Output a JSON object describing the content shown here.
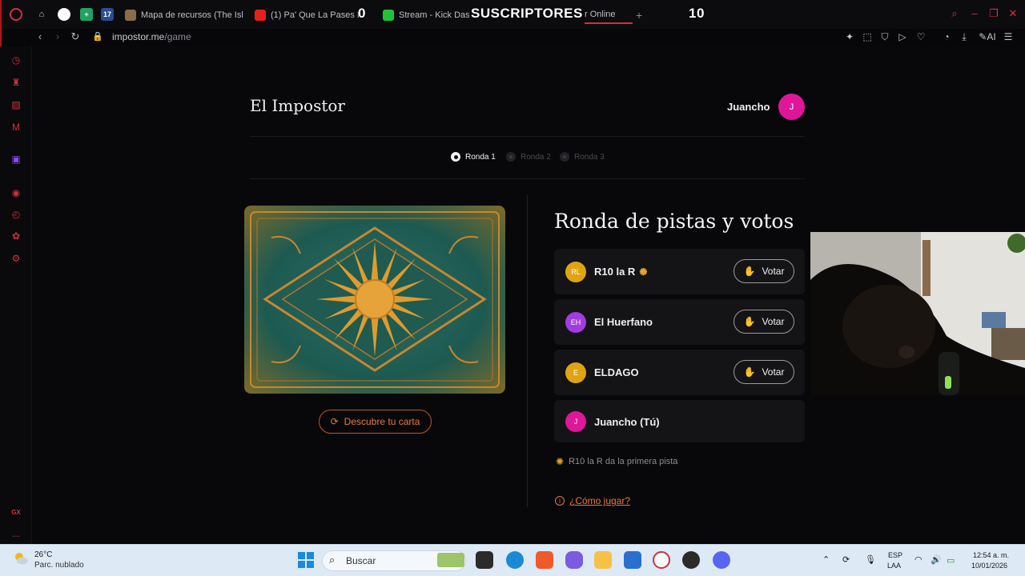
{
  "browser": {
    "tabs": [
      {
        "label": "Mapa de recursos (The Isl"
      },
      {
        "label": "(1) Pa' Que La Pases Bie"
      },
      {
        "label": "Stream - Kick Dash"
      },
      {
        "label": "r Online"
      }
    ],
    "overlay": {
      "subs_count_left": "0",
      "subs_title": "SUSCRIPTORES",
      "subs_count_right": "10"
    },
    "url_host": "impostor.me",
    "url_path": "/game",
    "ai_label": "AI",
    "app_badge": "17"
  },
  "sidebar": {
    "gx_label": "GX",
    "more_label": "..."
  },
  "app": {
    "title": "El Impostor",
    "user": {
      "name": "Juancho",
      "initial": "J"
    },
    "rounds": [
      {
        "label": "Ronda 1",
        "active": true
      },
      {
        "label": "Ronda 2",
        "active": false
      },
      {
        "label": "Ronda 3",
        "active": false
      }
    ],
    "reveal_button": "Descubre tu carta",
    "section_title": "Ronda de pistas y votos",
    "vote_label": "Votar",
    "players": [
      {
        "initials": "RL",
        "name": "R10 la R",
        "color": "#e0a312",
        "has_sun": true,
        "votable": true
      },
      {
        "initials": "EH",
        "name": "El Huerfano",
        "color": "#a23be0",
        "has_sun": false,
        "votable": true
      },
      {
        "initials": "E",
        "name": "ELDAGO",
        "color": "#e0a312",
        "has_sun": false,
        "votable": true
      },
      {
        "initials": "J",
        "name": "Juancho (Tú)",
        "color": "#e0169a",
        "has_sun": false,
        "votable": false
      }
    ],
    "clue_text": "R10 la R da la primera pista",
    "how_to_play": "¿Cómo jugar?"
  },
  "taskbar": {
    "temperature": "26°C",
    "weather": "Parc. nublado",
    "search_placeholder": "Buscar",
    "language": "ESP",
    "layout": "LAA",
    "time": "12:54 a. m.",
    "date": "10/01/2026"
  },
  "colors": {
    "accent": "#e8783a",
    "brand_red": "#d2303c"
  }
}
